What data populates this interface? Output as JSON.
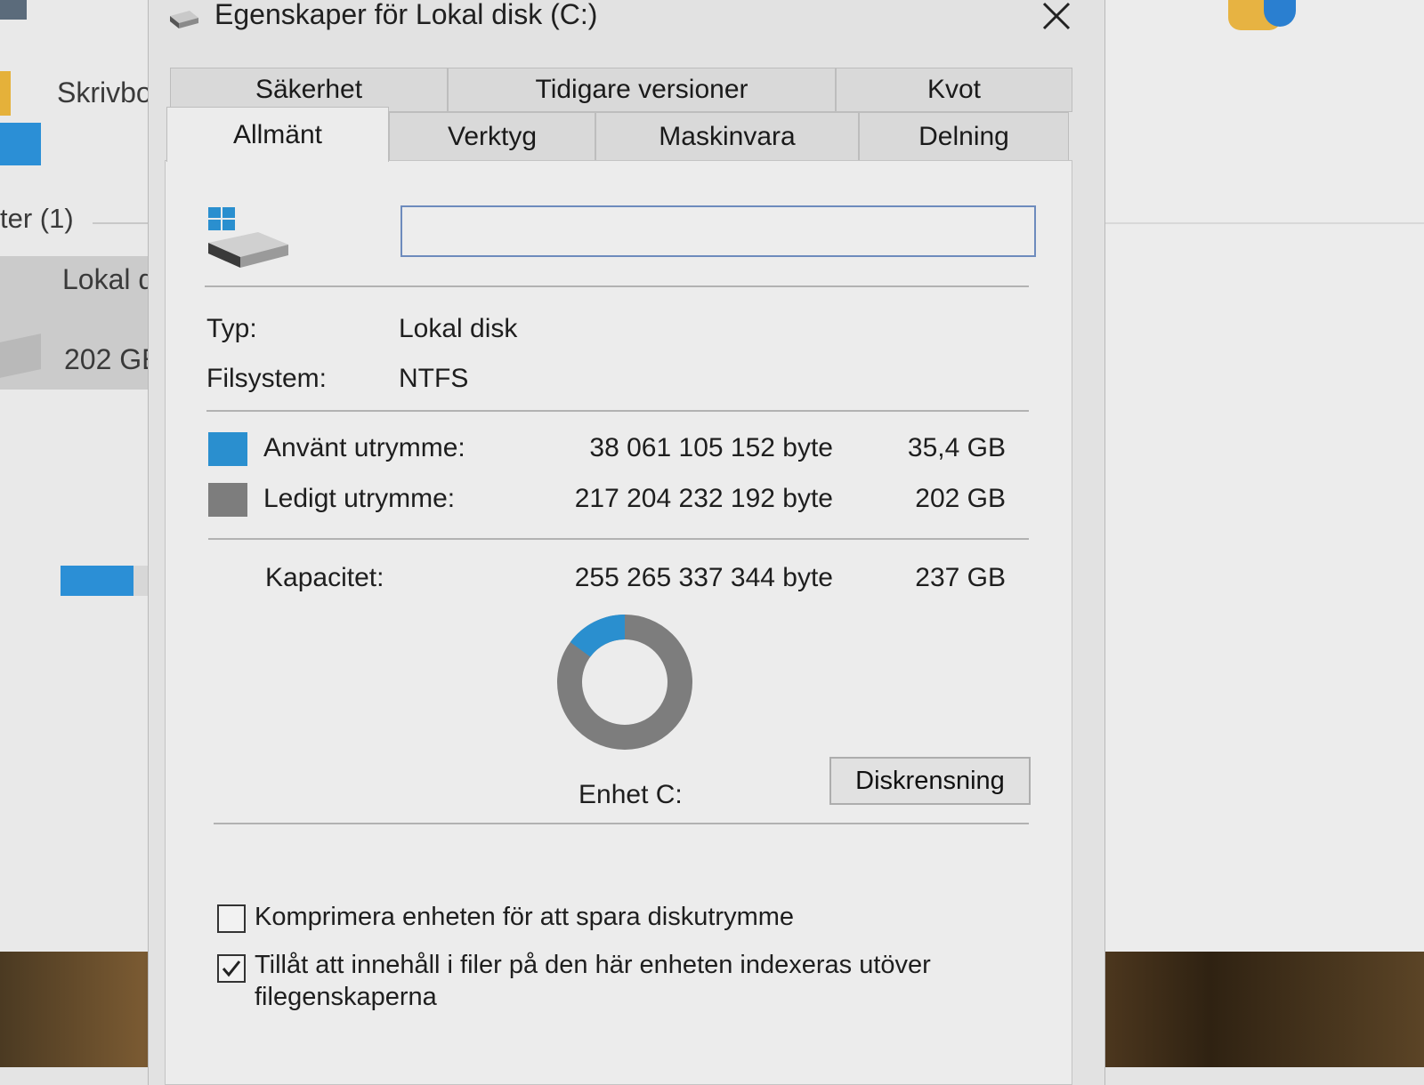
{
  "background": {
    "sidebar_text": "Skrivbo",
    "section_header": "ter (1)",
    "drive_name": "Lokal d",
    "drive_free": "202 GE"
  },
  "dialog": {
    "title": "Egenskaper för Lokal disk (C:)",
    "tabs_row1": [
      "Säkerhet",
      "Tidigare versioner",
      "Kvot"
    ],
    "tabs_row2": [
      "Allmänt",
      "Verktyg",
      "Maskinvara",
      "Delning"
    ],
    "active_tab": "Allmänt",
    "volume_label_value": "",
    "type_label": "Typ:",
    "type_value": "Lokal disk",
    "fs_label": "Filsystem:",
    "fs_value": "NTFS",
    "used": {
      "label": "Använt utrymme:",
      "bytes": "38 061 105 152 byte",
      "size": "35,4 GB",
      "color": "#2a8fcf"
    },
    "free": {
      "label": "Ledigt utrymme:",
      "bytes": "217 204 232 192 byte",
      "size": "202 GB",
      "color": "#7d7d7d"
    },
    "capacity": {
      "label": "Kapacitet:",
      "bytes": "255 265 337 344 byte",
      "size": "237 GB"
    },
    "drive_label": "Enhet C:",
    "cleanup_button": "Diskrensning",
    "compress_label": "Komprimera enheten för att spara diskutrymme",
    "compress_checked": false,
    "index_label_line1": "Tillåt att innehåll i filer på den här enheten indexeras utöver",
    "index_label_line2": "filegenskaperna",
    "index_checked": true
  },
  "chart_data": {
    "type": "pie",
    "categories": [
      "Använt utrymme:",
      "Ledigt utrymme:"
    ],
    "values": [
      38061105152,
      217204232192
    ],
    "colors": [
      "#2a8fcf",
      "#7d7d7d"
    ]
  }
}
